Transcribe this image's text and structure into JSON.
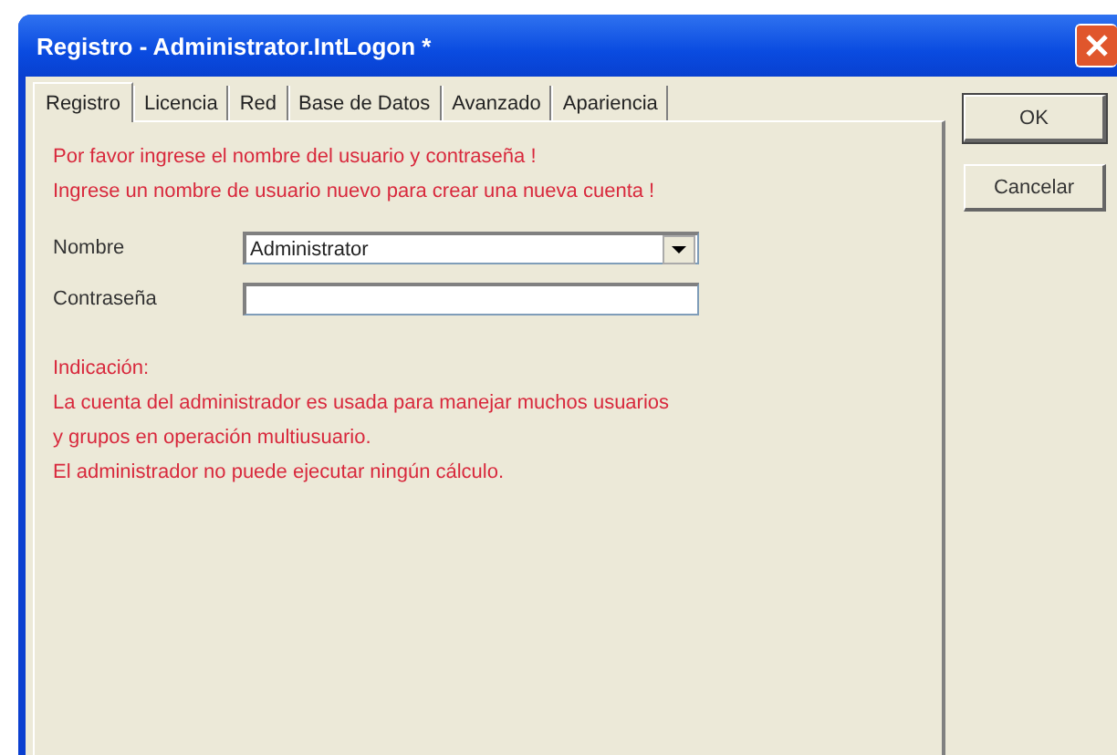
{
  "window": {
    "title": "Registro - Administrator.IntLogon *"
  },
  "tabs": [
    {
      "label": "Registro",
      "selected": true
    },
    {
      "label": "Licencia",
      "selected": false
    },
    {
      "label": "Red",
      "selected": false
    },
    {
      "label": "Base de Datos",
      "selected": false
    },
    {
      "label": "Avanzado",
      "selected": false
    },
    {
      "label": "Apariencia",
      "selected": false
    }
  ],
  "messages": [
    "Por favor ingrese el nombre del usuario y contraseña !",
    "Ingrese un nombre de usuario nuevo para crear una nueva cuenta !"
  ],
  "fields": [
    {
      "kind": "dropdown",
      "label": "Nombre",
      "value": "Administrator"
    },
    {
      "kind": "password",
      "label": "Contraseña"
    }
  ],
  "hint": {
    "heading": "Indicación:",
    "lines": [
      "La cuenta del administrador es usada para manejar muchos usuarios",
      "y grupos en operación multiusuario.",
      "El administrador no puede ejecutar ningún cálculo."
    ]
  },
  "buttons": [
    "OK",
    "Cancelar"
  ]
}
